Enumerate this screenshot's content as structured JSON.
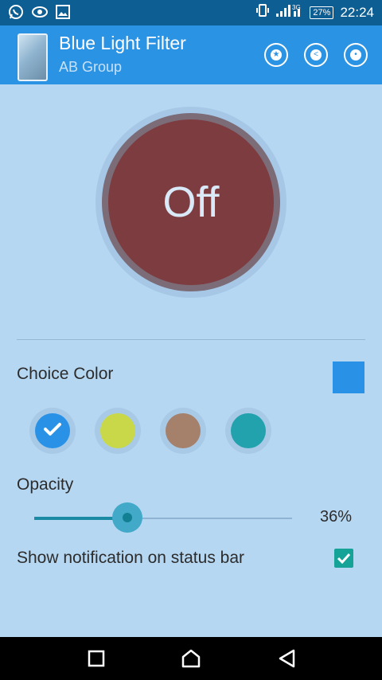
{
  "status_bar": {
    "time": "22:24",
    "battery": "27%",
    "network": "3G",
    "icons": [
      "whatsapp-icon",
      "eye-icon",
      "image-icon",
      "vibrate-icon",
      "signal-icon",
      "battery-icon"
    ]
  },
  "app_bar": {
    "title": "Blue Light Filter",
    "subtitle": "AB Group",
    "actions": [
      "star-icon",
      "share-icon",
      "more-icon"
    ],
    "color": "#2b93e4"
  },
  "main_toggle": {
    "label": "Off",
    "color": "#7d3c40"
  },
  "choice_color": {
    "label": "Choice Color",
    "selected_swatch_color": "#2a92e6",
    "options": [
      {
        "color": "#2a92e6",
        "selected": true
      },
      {
        "color": "#c8d848",
        "selected": false
      },
      {
        "color": "#a5806a",
        "selected": false
      },
      {
        "color": "#22a2ad",
        "selected": false
      }
    ]
  },
  "opacity": {
    "label": "Opacity",
    "value": 36,
    "value_text": "36%"
  },
  "notification": {
    "label": "Show notification on status bar",
    "checked": true
  },
  "nav_bar": [
    "recents-icon",
    "home-icon",
    "back-icon"
  ]
}
